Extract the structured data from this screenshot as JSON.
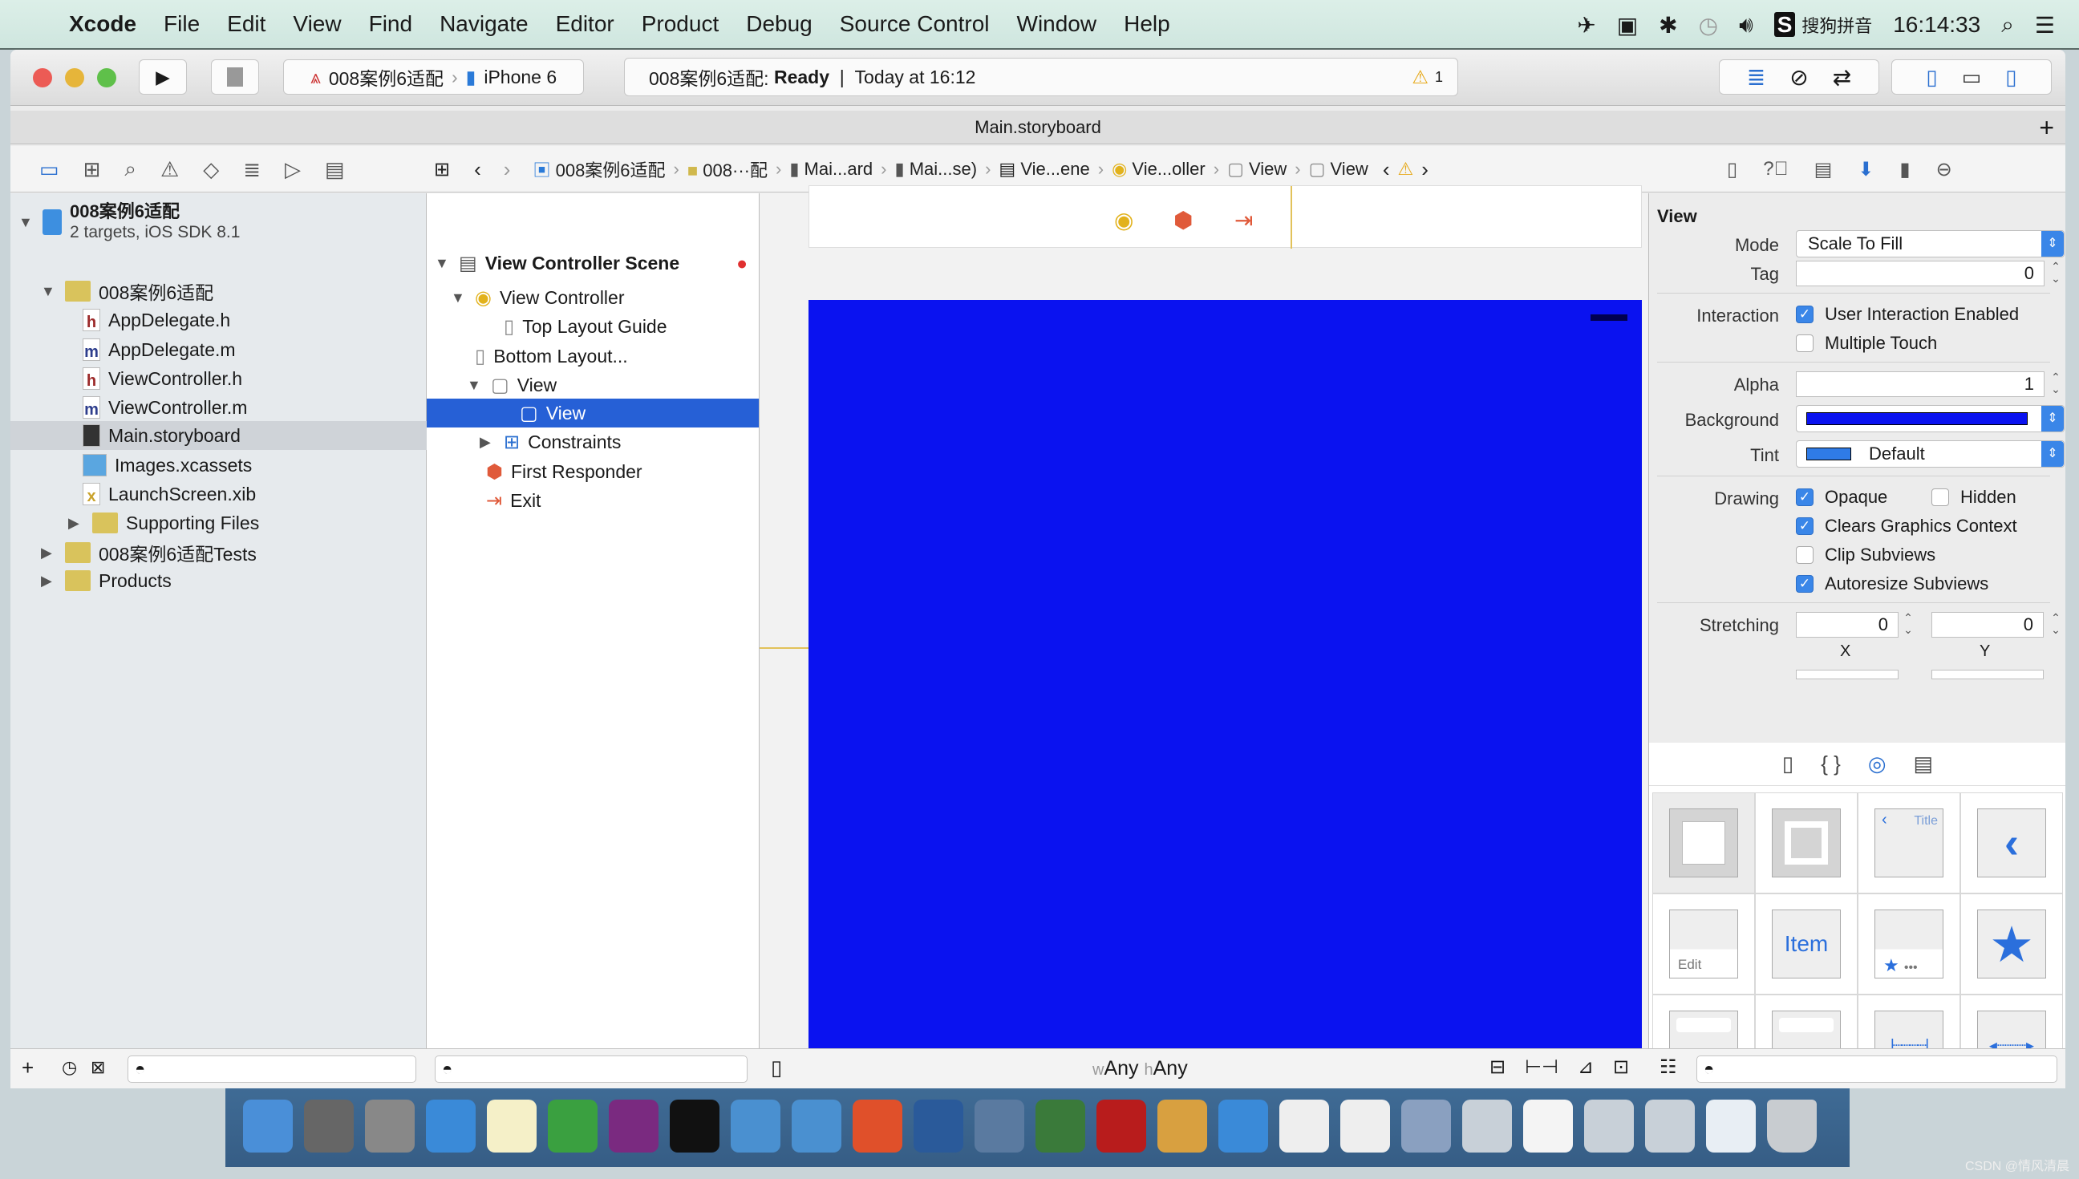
{
  "menubar": {
    "app": "Xcode",
    "items": [
      "File",
      "Edit",
      "View",
      "Find",
      "Navigate",
      "Editor",
      "Product",
      "Debug",
      "Source Control",
      "Window",
      "Help"
    ],
    "input_method": "搜狗拼音",
    "clock": "16:14:33"
  },
  "toolbar": {
    "scheme": "008案例6适配",
    "device": "iPhone 6",
    "activity_project": "008案例6适配:",
    "activity_state": "Ready",
    "activity_time": "Today at 16:12",
    "warning_count": "1"
  },
  "tab": {
    "title": "Main.storyboard"
  },
  "jumpbar": [
    "008案例6适配",
    "008···配",
    "Mai...ard",
    "Mai...se)",
    "Vie...ene",
    "Vie...oller",
    "View",
    "View"
  ],
  "navigator": {
    "project": "008案例6适配",
    "project_sub": "2 targets, iOS SDK 8.1",
    "items": [
      {
        "label": "008案例6适配",
        "kind": "folder",
        "expanded": true
      },
      {
        "label": "AppDelegate.h",
        "kind": "h"
      },
      {
        "label": "AppDelegate.m",
        "kind": "m"
      },
      {
        "label": "ViewController.h",
        "kind": "h"
      },
      {
        "label": "ViewController.m",
        "kind": "m"
      },
      {
        "label": "Main.storyboard",
        "kind": "storyboard",
        "selected": true
      },
      {
        "label": "Images.xcassets",
        "kind": "assets"
      },
      {
        "label": "LaunchScreen.xib",
        "kind": "xib"
      },
      {
        "label": "Supporting Files",
        "kind": "folder"
      },
      {
        "label": "008案例6适配Tests",
        "kind": "folder"
      },
      {
        "label": "Products",
        "kind": "folder"
      }
    ]
  },
  "outline": {
    "items": [
      "View Controller Scene",
      "View Controller",
      "Top Layout Guide",
      "Bottom Layout...",
      "View",
      "View",
      "Constraints",
      "First Responder",
      "Exit"
    ]
  },
  "canvas": {
    "size_class_w": "Any",
    "size_class_h": "Any",
    "view_background": "#0a12f0"
  },
  "inspector": {
    "section": "View",
    "mode_label": "Mode",
    "mode": "Scale To Fill",
    "tag_label": "Tag",
    "tag": "0",
    "interaction_label": "Interaction",
    "user_interaction": "User Interaction Enabled",
    "multiple_touch": "Multiple Touch",
    "alpha_label": "Alpha",
    "alpha": "1",
    "background_label": "Background",
    "background_color": "#0a12f0",
    "tint_label": "Tint",
    "tint": "Default",
    "tint_color": "#2f7be6",
    "drawing_label": "Drawing",
    "opaque": "Opaque",
    "hidden": "Hidden",
    "clears": "Clears Graphics Context",
    "clip": "Clip Subviews",
    "autoresize": "Autoresize Subviews",
    "stretching_label": "Stretching",
    "stretch_x": "0",
    "stretch_y": "0",
    "x_label": "X",
    "y_label": "Y",
    "checks": {
      "user_interaction": true,
      "multiple_touch": false,
      "opaque": true,
      "hidden": false,
      "clears": true,
      "clip": false,
      "autoresize": true
    }
  },
  "library": {
    "title_tile": "Title",
    "item_tile": "Item",
    "edit_tile": "Edit"
  },
  "watermark": "CSDN @情风清晨"
}
